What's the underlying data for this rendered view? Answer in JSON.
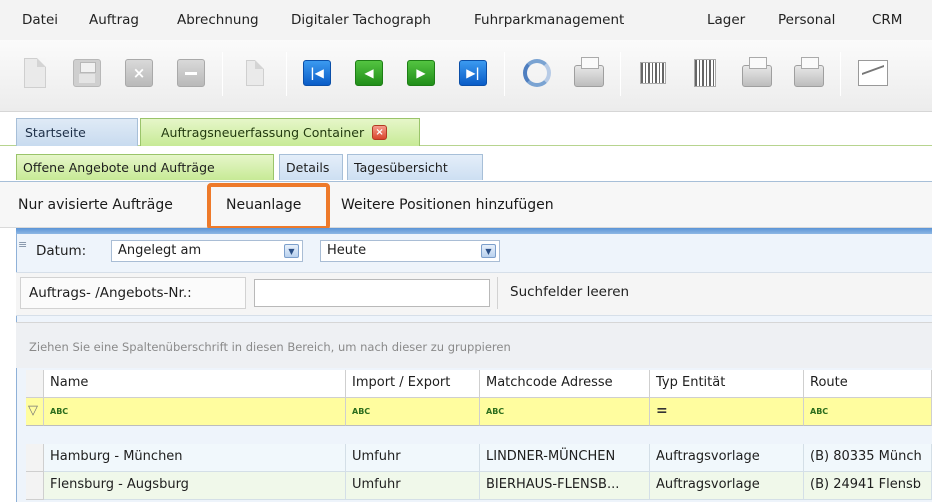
{
  "menu": [
    "Datei",
    "Auftrag",
    "Abrechnung",
    "Digitaler Tachograph",
    "Fuhrparkmanagement",
    "Lager",
    "Personal",
    "CRM"
  ],
  "toolbar": {
    "icons": [
      "new-document-icon",
      "save-icon",
      "cancel-icon",
      "minus-icon",
      "copy-icon",
      "first-record-icon",
      "previous-record-icon",
      "next-record-icon",
      "last-record-icon",
      "refresh-icon",
      "print-icon",
      "barcode-icon",
      "barcode-print-icon",
      "print-preview-icon",
      "export-icon",
      "chart-icon"
    ]
  },
  "tabs": [
    {
      "label": "Startseite",
      "active": false
    },
    {
      "label": "Auftragsneuerfassung Container",
      "active": true
    }
  ],
  "subtabs": [
    {
      "label": "Offene Angebote und Aufträge",
      "active": true
    },
    {
      "label": "Details",
      "active": false
    },
    {
      "label": "Tagesübersicht",
      "active": false
    }
  ],
  "actions": {
    "nur_avisierte": "Nur avisierte Aufträge",
    "neuanlage": "Neuanlage",
    "weitere": "Weitere Positionen hinzufügen"
  },
  "filter": {
    "datum_label": "Datum:",
    "datum_type": "Angelegt am",
    "datum_range": "Heute",
    "nr_label": "Auftrags- /Angebots-Nr.:",
    "nr_value": "",
    "clear_label": "Suchfelder leeren"
  },
  "group_hint": "Ziehen Sie eine Spaltenüberschrift in diesen Bereich, um nach dieser zu gruppieren",
  "grid": {
    "columns": [
      "Name",
      "Import / Export",
      "Matchcode Adresse",
      "Typ Entität",
      "Route"
    ],
    "filter_row": [
      "ABC",
      "ABC",
      "ABC",
      "=",
      "ABC"
    ],
    "rows": [
      [
        "Hamburg - München",
        "Umfuhr",
        "LINDNER-MÜNCHEN",
        "Auftragsvorlage",
        "(B) 80335 Münch"
      ],
      [
        "Flensburg - Augsburg",
        "Umfuhr",
        "BIERHAUS-FLENSB...",
        "Auftragsvorlage",
        "(B) 24941 Flensb"
      ]
    ]
  },
  "colors": {
    "highlight": "#ee7a2a",
    "active_tab": "#c7ea96",
    "filter_row": "#fffd9f"
  }
}
